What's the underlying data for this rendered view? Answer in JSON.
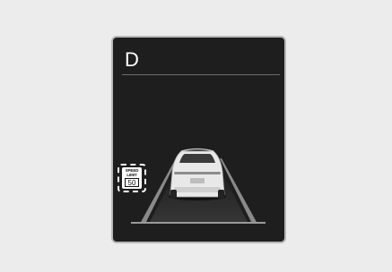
{
  "cluster": {
    "gear": "D",
    "speed_limit_sign": {
      "line1": "SPEED",
      "line2": "LIMIT",
      "value": "50"
    }
  },
  "colors": {
    "background": "#ececec",
    "screen": "#1e1e1e",
    "frame": "#b7b7b7",
    "highlight": "#ffffff"
  },
  "icons": {
    "vehicle": "car-rear-icon",
    "highlight": "dashed-highlight-frame"
  }
}
